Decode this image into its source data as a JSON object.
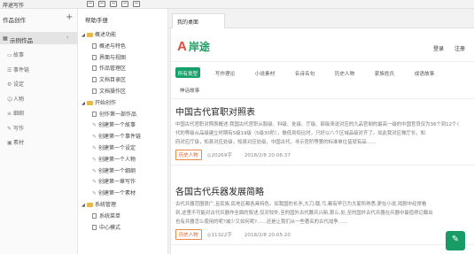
{
  "app": {
    "title": "岸途写作"
  },
  "left_panel": {
    "title": "作品创作",
    "add_label": "+",
    "work": {
      "label": "示例作品",
      "chevron": "‹"
    },
    "nav": [
      {
        "icon": "book-icon",
        "glyph": "▭",
        "label": "故事"
      },
      {
        "icon": "list-icon",
        "glyph": "☰",
        "label": "事件链"
      },
      {
        "icon": "settings-icon",
        "glyph": "⚙",
        "label": "设定"
      },
      {
        "icon": "person-icon",
        "glyph": "☺",
        "label": "人物"
      },
      {
        "icon": "outline-icon",
        "glyph": "≡",
        "label": "细纲"
      },
      {
        "icon": "write-icon",
        "glyph": "✎",
        "label": "写作"
      },
      {
        "icon": "material-icon",
        "glyph": "▣",
        "label": "素材"
      }
    ]
  },
  "middle_panel": {
    "title": "帮助手册",
    "tree": [
      {
        "type": "folder",
        "level": 0,
        "label": "概述功能"
      },
      {
        "type": "file",
        "level": 1,
        "label": "概述与特色"
      },
      {
        "type": "file",
        "level": 1,
        "label": "界面与视图"
      },
      {
        "type": "file",
        "level": 1,
        "label": "作品管理区"
      },
      {
        "type": "file",
        "level": 1,
        "label": "文档目录区"
      },
      {
        "type": "file",
        "level": 1,
        "label": "文档操作区"
      },
      {
        "type": "folder",
        "level": 0,
        "label": "开始创作"
      },
      {
        "type": "file",
        "level": 1,
        "label": "创作第一部作品"
      },
      {
        "type": "pen",
        "level": 1,
        "label": "创建第一个故事"
      },
      {
        "type": "pen",
        "level": 1,
        "label": "创建第一个事件链"
      },
      {
        "type": "pen",
        "level": 1,
        "label": "创建第一个设定"
      },
      {
        "type": "pen",
        "level": 1,
        "label": "创建第一个人物"
      },
      {
        "type": "pen",
        "level": 1,
        "label": "创建第一个细纲"
      },
      {
        "type": "pen",
        "level": 1,
        "label": "创建第一章写作"
      },
      {
        "type": "pen",
        "level": 1,
        "label": "创建第一个素材"
      },
      {
        "type": "folder",
        "level": 0,
        "label": "系统管理"
      },
      {
        "type": "file",
        "level": 1,
        "label": "系统菜单"
      },
      {
        "type": "file",
        "level": 1,
        "label": "中心模式"
      }
    ]
  },
  "right_panel": {
    "tab_label": "我的桌面",
    "site": {
      "logo_mark": "A",
      "logo_text": "岸途",
      "login": "登录",
      "register": "注册",
      "categories": [
        {
          "label": "所有类型",
          "active": true
        },
        {
          "label": "写作理论",
          "active": false
        },
        {
          "label": "小说素材",
          "active": false
        },
        {
          "label": "名诗名句",
          "active": false
        },
        {
          "label": "历史人物",
          "active": false
        },
        {
          "label": "家族姓氏",
          "active": false
        },
        {
          "label": "成语故事",
          "active": false
        },
        {
          "label": "神话故事",
          "active": false
        }
      ],
      "articles": [
        {
          "title": "中国古代官职对照表",
          "summary_lines": [
            "中国古代官职对照表概述:我国古代官职从股级、科级、处级、厅级、部级来说对应的九品官制的最高一级的中国官员仅为36个到12个小等级，而古",
            "代的等级从品级建立时期有5级19级（5级30阶），做低到衔比时，只好以八个区域品级对齐了。如此我对应做厅长，知",
            "府对应厅级，知县对应处级，知县对应处级，中国古代，寻示官阶等第的标准单位皆就有品……"
          ],
          "tag": "历史人物",
          "views": "◎20269字",
          "date": "2018/2/8 20:06:37"
        },
        {
          "title": "各国古代兵器发展简略",
          "summary_lines": [
            "古代兵器范围很广,且民族,民地区都各具特色。如我国的长矛,大刀,戟,弓,都有早已为大家所熟悉,更在小说,戏剧中经常看",
            "到,这里不可能对古代兵器作全面的叙述,仅对较外,至的国外古代戴兵兴新,那么,处,至的国外古代兵器在兵器中最值得记载出",
            "也有兵器怎么使用的呢?减少又如何呢?……还是让我们从一些著名的古代战争……"
          ],
          "tag": "历史人物",
          "views": "◎11322字",
          "date": "2018/2/8 20:05:20"
        }
      ]
    }
  },
  "fab": {
    "glyph": "✎"
  },
  "colors": {
    "accent": "#189c66",
    "logo_red": "#e24a3e",
    "folder": "#e8b84a"
  }
}
